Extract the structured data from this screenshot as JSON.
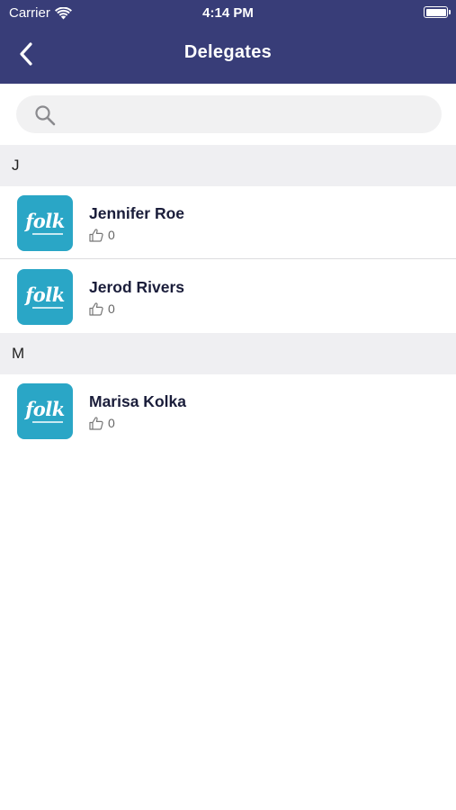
{
  "status_bar": {
    "carrier": "Carrier",
    "time": "4:14 PM"
  },
  "header": {
    "title": "Delegates"
  },
  "search": {
    "placeholder": ""
  },
  "sections": [
    {
      "letter": "J",
      "items": [
        {
          "name": "Jennifer Roe",
          "likes": "0",
          "logo_text": "folk"
        },
        {
          "name": "Jerod Rivers",
          "likes": "0",
          "logo_text": "folk"
        }
      ]
    },
    {
      "letter": "M",
      "items": [
        {
          "name": "Marisa Kolka",
          "likes": "0",
          "logo_text": "folk"
        }
      ]
    }
  ],
  "colors": {
    "header_bg": "#383d78",
    "avatar_bg": "#2aa6c6",
    "section_bg": "#efeff2"
  },
  "icons": {
    "back": "chevron-left-icon",
    "search": "search-icon",
    "likes": "thumbs-up-icon",
    "wifi": "wifi-icon",
    "battery": "battery-icon"
  }
}
